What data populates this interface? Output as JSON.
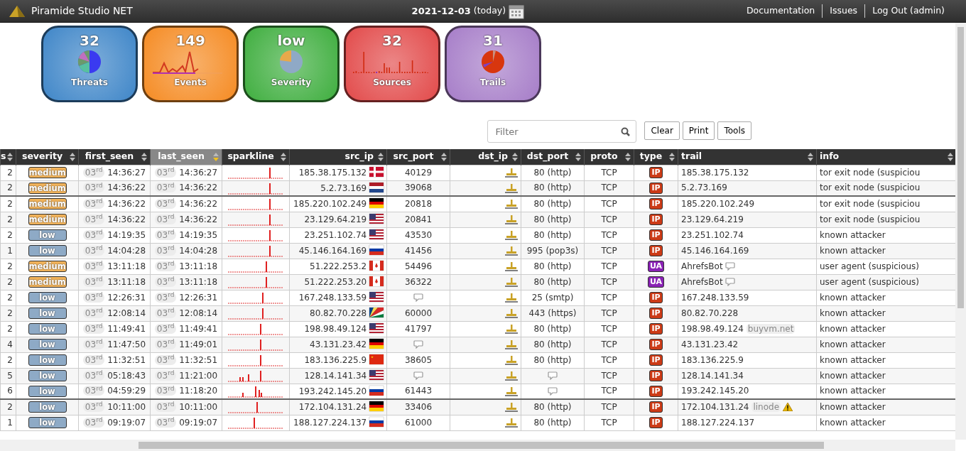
{
  "header": {
    "title": "Piramide Studio NET",
    "date": "2021-12-03",
    "date_note": "(today)",
    "links": [
      "Documentation",
      "Issues",
      "Log Out (admin)"
    ]
  },
  "tiles": [
    {
      "value": "32",
      "label": "Threats",
      "kind": "pie",
      "color": "#3f86c8"
    },
    {
      "value": "149",
      "label": "Events",
      "kind": "line",
      "color": "#f58b23"
    },
    {
      "value": "low",
      "label": "Severity",
      "kind": "donut",
      "color": "#3fae3f"
    },
    {
      "value": "32",
      "label": "Sources",
      "kind": "bars",
      "color": "#e24a4a"
    },
    {
      "value": "31",
      "label": "Trails",
      "kind": "pie2",
      "color": "#a67dc8"
    }
  ],
  "filter": {
    "placeholder": "Filter"
  },
  "buttons": [
    "Clear",
    "Print",
    "Tools"
  ],
  "table": {
    "columns": [
      {
        "label": "s",
        "sorted": false
      },
      {
        "label": "severity",
        "sorted": false
      },
      {
        "label": "first_seen",
        "sorted": false
      },
      {
        "label": "last_seen",
        "sorted": true
      },
      {
        "label": "sparkline",
        "sorted": false
      },
      {
        "label": "src_ip",
        "sorted": false
      },
      {
        "label": "src_port",
        "sorted": false
      },
      {
        "label": "dst_ip",
        "sorted": false
      },
      {
        "label": "dst_port",
        "sorted": false
      },
      {
        "label": "proto",
        "sorted": false
      },
      {
        "label": "type",
        "sorted": false
      },
      {
        "label": "trail",
        "sorted": false
      },
      {
        "label": "info",
        "sorted": false
      }
    ],
    "rows": [
      {
        "count": "2",
        "severity": {
          "label": "medium",
          "color": "#f2b35a"
        },
        "first_date": "03$^{rd}$",
        "first_time": "14:36:27",
        "last_date": "03$^{rd}$",
        "last_time": "14:36:27",
        "src_ip": "185.38.175.132",
        "flag": {
          "kind": "dk"
        },
        "src_port": "40129",
        "dst_port": "80 (http)",
        "proto": "TCP",
        "type": {
          "label": "IP",
          "color": "#cc3b17"
        },
        "trail": "185.38.175.132",
        "info": "tor exit node (suspiciou",
        "group_break": false
      },
      {
        "count": "2",
        "severity": {
          "label": "medium",
          "color": "#f2b35a"
        },
        "first_date": "03$^{rd}$",
        "first_time": "14:36:22",
        "last_date": "03$^{rd}$",
        "last_time": "14:36:22",
        "src_ip": "5.2.73.169",
        "flag": {
          "kind": "nl"
        },
        "src_port": "39068",
        "dst_port": "80 (http)",
        "proto": "TCP",
        "type": {
          "label": "IP",
          "color": "#cc3b17"
        },
        "trail": "5.2.73.169",
        "info": "tor exit node (suspiciou",
        "group_break": false
      },
      {
        "count": "2",
        "severity": {
          "label": "medium",
          "color": "#f2b35a"
        },
        "first_date": "03$^{rd}$",
        "first_time": "14:36:22",
        "last_date": "03$^{rd}$",
        "last_time": "14:36:22",
        "src_ip": "185.220.102.249",
        "flag": {
          "kind": "de"
        },
        "src_port": "20818",
        "dst_port": "80 (http)",
        "proto": "TCP",
        "type": {
          "label": "IP",
          "color": "#cc3b17"
        },
        "trail": "185.220.102.249",
        "info": "tor exit node (suspiciou",
        "group_break": true
      },
      {
        "count": "2",
        "severity": {
          "label": "medium",
          "color": "#f2b35a"
        },
        "first_date": "03$^{rd}$",
        "first_time": "14:36:22",
        "last_date": "03$^{rd}$",
        "last_time": "14:36:22",
        "src_ip": "23.129.64.219",
        "flag": {
          "kind": "us"
        },
        "src_port": "20841",
        "dst_port": "80 (http)",
        "proto": "TCP",
        "type": {
          "label": "IP",
          "color": "#cc3b17"
        },
        "trail": "23.129.64.219",
        "info": "tor exit node (suspiciou",
        "group_break": false
      },
      {
        "count": "2",
        "severity": {
          "label": "low",
          "color": "#8eaac6"
        },
        "first_date": "03$^{rd}$",
        "first_time": "14:19:35",
        "last_date": "03$^{rd}$",
        "last_time": "14:19:35",
        "src_ip": "23.251.102.74",
        "flag": {
          "kind": "us"
        },
        "src_port": "43530",
        "dst_port": "80 (http)",
        "proto": "TCP",
        "type": {
          "label": "IP",
          "color": "#cc3b17"
        },
        "trail": "23.251.102.74",
        "info": "known attacker",
        "group_break": false
      },
      {
        "count": "1",
        "severity": {
          "label": "low",
          "color": "#8eaac6"
        },
        "first_date": "03$^{rd}$",
        "first_time": "14:04:28",
        "last_date": "03$^{rd}$",
        "last_time": "14:04:28",
        "src_ip": "45.146.164.169",
        "flag": {
          "kind": "ru"
        },
        "src_port": "41456",
        "dst_port": "995 (pop3s)",
        "proto": "TCP",
        "type": {
          "label": "IP",
          "color": "#cc3b17"
        },
        "trail": "45.146.164.169",
        "info": "known attacker",
        "group_break": false
      },
      {
        "count": "2",
        "severity": {
          "label": "medium",
          "color": "#f2b35a"
        },
        "first_date": "03$^{rd}$",
        "first_time": "13:11:18",
        "last_date": "03$^{rd}$",
        "last_time": "13:11:18",
        "src_ip": "51.222.253.2",
        "flag": {
          "kind": "ca"
        },
        "src_port": "54496",
        "dst_port": "80 (http)",
        "proto": "TCP",
        "type": {
          "label": "UA",
          "color": "#8a22b5"
        },
        "trail": "AhrefsBot",
        "trail_comment": true,
        "info": "user agent (suspicious)",
        "group_break": false
      },
      {
        "count": "2",
        "severity": {
          "label": "medium",
          "color": "#f2b35a"
        },
        "first_date": "03$^{rd}$",
        "first_time": "13:11:18",
        "last_date": "03$^{rd}$",
        "last_time": "13:11:18",
        "src_ip": "51.222.253.20",
        "flag": {
          "kind": "ca"
        },
        "src_port": "36322",
        "dst_port": "80 (http)",
        "proto": "TCP",
        "type": {
          "label": "UA",
          "color": "#8a22b5"
        },
        "trail": "AhrefsBot",
        "trail_comment": true,
        "info": "user agent (suspicious)",
        "group_break": false
      },
      {
        "count": "2",
        "severity": {
          "label": "low",
          "color": "#8eaac6"
        },
        "first_date": "03$^{rd}$",
        "first_time": "12:26:31",
        "last_date": "03$^{rd}$",
        "last_time": "12:26:31",
        "src_ip": "167.248.133.59",
        "flag": {
          "kind": "us"
        },
        "dst_port": "25 (smtp)",
        "proto": "TCP",
        "type": {
          "label": "IP",
          "color": "#cc3b17"
        },
        "trail": "167.248.133.59",
        "info": "known attacker",
        "group_break": false
      },
      {
        "count": "2",
        "severity": {
          "label": "low",
          "color": "#8eaac6"
        },
        "first_date": "03$^{rd}$",
        "first_time": "12:08:14",
        "last_date": "03$^{rd}$",
        "last_time": "12:08:14",
        "src_ip": "80.82.70.228",
        "flag": {
          "kind": "sc"
        },
        "src_port": "60000",
        "dst_port": "443 (https)",
        "proto": "TCP",
        "type": {
          "label": "IP",
          "color": "#cc3b17"
        },
        "trail": "80.82.70.228",
        "info": "known attacker",
        "group_break": false
      },
      {
        "count": "2",
        "severity": {
          "label": "low",
          "color": "#8eaac6"
        },
        "first_date": "03$^{rd}$",
        "first_time": "11:49:41",
        "last_date": "03$^{rd}$",
        "last_time": "11:49:41",
        "src_ip": "198.98.49.124",
        "flag": {
          "kind": "us"
        },
        "src_port": "41797",
        "dst_port": "80 (http)",
        "proto": "TCP",
        "type": {
          "label": "IP",
          "color": "#cc3b17"
        },
        "trail": "198.98.49.124",
        "trail_tag": "buyvm.net",
        "info": "known attacker",
        "group_break": false
      },
      {
        "count": "4",
        "severity": {
          "label": "low",
          "color": "#8eaac6"
        },
        "first_date": "03$^{rd}$",
        "first_time": "11:47:50",
        "last_date": "03$^{rd}$",
        "last_time": "11:49:01",
        "src_ip": "43.131.23.42",
        "flag": {
          "kind": "de"
        },
        "dst_port": "80 (http)",
        "proto": "TCP",
        "type": {
          "label": "IP",
          "color": "#cc3b17"
        },
        "trail": "43.131.23.42",
        "info": "known attacker",
        "group_break": false
      },
      {
        "count": "2",
        "severity": {
          "label": "low",
          "color": "#8eaac6"
        },
        "first_date": "03$^{rd}$",
        "first_time": "11:32:51",
        "last_date": "03$^{rd}$",
        "last_time": "11:32:51",
        "src_ip": "183.136.225.9",
        "flag": {
          "kind": "cn"
        },
        "src_port": "38605",
        "dst_port": "80 (http)",
        "proto": "TCP",
        "type": {
          "label": "IP",
          "color": "#cc3b17"
        },
        "trail": "183.136.225.9",
        "info": "known attacker",
        "group_break": false
      },
      {
        "count": "5",
        "severity": {
          "label": "low",
          "color": "#8eaac6"
        },
        "first_date": "03$^{rd}$",
        "first_time": "05:18:43",
        "last_date": "03$^{rd}$",
        "last_time": "11:21:00",
        "src_ip": "128.14.141.34",
        "flag": {
          "kind": "us"
        },
        "proto": "TCP",
        "type": {
          "label": "IP",
          "color": "#cc3b17"
        },
        "trail": "128.14.141.34",
        "info": "known attacker",
        "group_break": false
      },
      {
        "count": "6",
        "severity": {
          "label": "low",
          "color": "#8eaac6"
        },
        "first_date": "03$^{rd}$",
        "first_time": "04:59:29",
        "last_date": "03$^{rd}$",
        "last_time": "11:18:20",
        "src_ip": "193.242.145.20",
        "flag": {
          "kind": "ru"
        },
        "src_port": "61443",
        "proto": "TCP",
        "type": {
          "label": "IP",
          "color": "#cc3b17"
        },
        "trail": "193.242.145.20",
        "info": "known attacker",
        "group_break": false
      },
      {
        "count": "2",
        "severity": {
          "label": "low",
          "color": "#8eaac6"
        },
        "first_date": "03$^{rd}$",
        "first_time": "10:11:00",
        "last_date": "03$^{rd}$",
        "last_time": "10:11:00",
        "src_ip": "172.104.131.24",
        "flag": {
          "kind": "de"
        },
        "src_port": "33406",
        "dst_port": "80 (http)",
        "proto": "TCP",
        "type": {
          "label": "IP",
          "color": "#cc3b17"
        },
        "trail": "172.104.131.24",
        "trail_tag": "linode",
        "trail_warning": true,
        "info": "known attacker",
        "group_break": true
      },
      {
        "count": "1",
        "severity": {
          "label": "low",
          "color": "#8eaac6"
        },
        "first_date": "03$^{rd}$",
        "first_time": "09:19:07",
        "last_date": "03$^{rd}$",
        "last_time": "09:19:07",
        "src_ip": "188.127.224.137",
        "flag": {
          "kind": "ru"
        },
        "src_port": "61000",
        "dst_port": "80 (http)",
        "proto": "TCP",
        "type": {
          "label": "IP",
          "color": "#cc3b17"
        },
        "trail": "188.127.224.137",
        "info": "known attacker",
        "group_break": false
      }
    ]
  }
}
